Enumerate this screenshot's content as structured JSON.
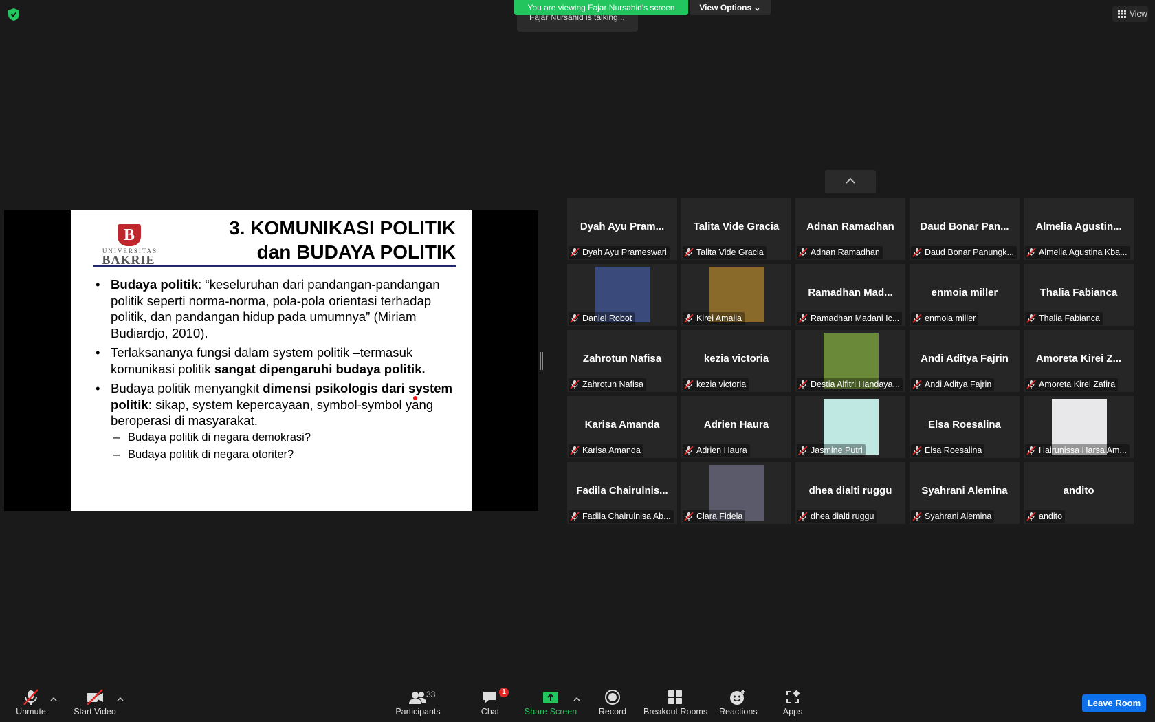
{
  "banner": {
    "viewing": "You are viewing Fajar Nursahid's screen",
    "view_options": "View Options",
    "talking": "Fajar Nursahid is talking...",
    "view": "View"
  },
  "slide": {
    "logo_top": "UNIVERSITAS",
    "logo_bottom": "BAKRIE",
    "logo_mark": "B",
    "title_line1": "3. KOMUNIKASI POLITIK",
    "title_line2": "dan BUDAYA POLITIK",
    "b1_bold": "Budaya politik",
    "b1_rest": ": “keseluruhan dari pandangan-pandangan politik seperti norma-norma, pola-pola orientasi terhadap politik, dan pandangan hidup pada umumnya” (Miriam Budiardjo, 2010).",
    "b2_plain": "Terlaksananya fungsi dalam system politik –termasuk komunikasi politik ",
    "b2_bold": "sangat dipengaruhi budaya politik.",
    "b3_plain": "Budaya politik menyangkit ",
    "b3_bold": "dimensi psikologis dari system politik",
    "b3_rest": ": sikap, system kepercayaan, symbol-symbol yang beroperasi di masyarakat.",
    "sub1": "Budaya politik  di negara demokrasi?",
    "sub2": "Budaya politik  di negara otoriter?"
  },
  "tiles": [
    {
      "big": "Dyah Ayu Pram...",
      "label": "Dyah Ayu Prameswari"
    },
    {
      "big": "Talita Vide Gracia",
      "label": "Talita Vide Gracia"
    },
    {
      "big": "Adnan Ramadhan",
      "label": "Adnan Ramadhan"
    },
    {
      "big": "Daud Bonar Pan...",
      "label": "Daud Bonar Panungk..."
    },
    {
      "big": "Almelia Agustin...",
      "label": "Almelia Agustina Kba..."
    },
    {
      "big": "",
      "label": "Daniel Robot",
      "photo": "#3a4a7a"
    },
    {
      "big": "",
      "label": "Kirei Amalia",
      "photo": "#8a6a2a"
    },
    {
      "big": "Ramadhan Mad...",
      "label": "Ramadhan Madani Ic..."
    },
    {
      "big": "enmoia miller",
      "label": "enmoia miller"
    },
    {
      "big": "Thalia Fabianca",
      "label": "Thalia Fabianca"
    },
    {
      "big": "Zahrotun Nafisa",
      "label": "Zahrotun Nafisa"
    },
    {
      "big": "kezia victoria",
      "label": "kezia victoria"
    },
    {
      "big": "",
      "label": "Destia Alfitri Handaya...",
      "photo": "#6a8a3a"
    },
    {
      "big": "Andi Aditya Fajrin",
      "label": "Andi Aditya Fajrin"
    },
    {
      "big": "Amoreta Kirei Z...",
      "label": "Amoreta Kirei Zafira"
    },
    {
      "big": "Karisa Amanda",
      "label": "Karisa Amanda"
    },
    {
      "big": "Adrien Haura",
      "label": "Adrien Haura"
    },
    {
      "big": "",
      "label": "Jasmine Putri",
      "photo": "#bfe8e3"
    },
    {
      "big": "Elsa Roesalina",
      "label": "Elsa Roesalina"
    },
    {
      "big": "",
      "label": "Hairunissa Harsa Am...",
      "photo": "#e8e8ea"
    },
    {
      "big": "Fadila Chairulnis...",
      "label": "Fadila Chairulnisa Ab..."
    },
    {
      "big": "",
      "label": "Clara Fidela",
      "photo": "#5a5a6a"
    },
    {
      "big": "dhea dialti ruggu",
      "label": "dhea dialti ruggu"
    },
    {
      "big": "Syahrani Alemina",
      "label": "Syahrani Alemina"
    },
    {
      "big": "andito",
      "label": "andito"
    }
  ],
  "toolbar": {
    "unmute": "Unmute",
    "start_video": "Start Video",
    "participants": "Participants",
    "participants_count": "33",
    "chat": "Chat",
    "chat_badge": "1",
    "share_screen": "Share Screen",
    "record": "Record",
    "breakout": "Breakout Rooms",
    "reactions": "Reactions",
    "apps": "Apps",
    "leave": "Leave Room"
  },
  "colors": {
    "accent_green": "#22c55e",
    "leave_blue": "#0e71eb",
    "mute_red": "#e02828",
    "badge_red": "#e02828"
  }
}
